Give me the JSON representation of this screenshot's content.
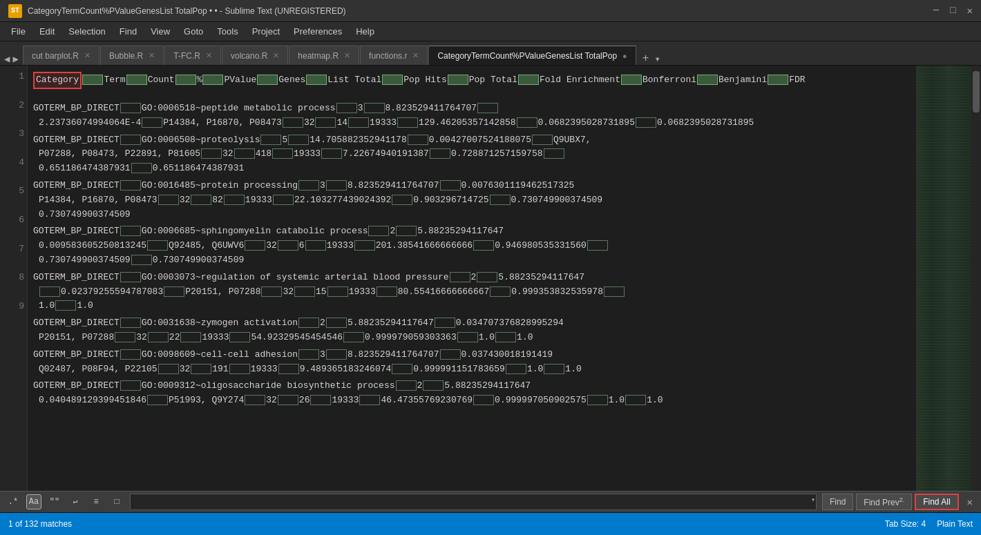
{
  "titlebar": {
    "icon_label": "ST",
    "title": "CategoryTermCount%PValueGenesList TotalPop • • - Sublime Text (UNREGISTERED)",
    "minimize": "─",
    "maximize": "□",
    "close": "✕"
  },
  "menubar": {
    "items": [
      "File",
      "Edit",
      "Selection",
      "Find",
      "View",
      "Goto",
      "Tools",
      "Project",
      "Preferences",
      "Help"
    ]
  },
  "tabs": [
    {
      "label": "cut barplot.R",
      "active": false,
      "closeable": true
    },
    {
      "label": "Bubble.R",
      "active": false,
      "closeable": true
    },
    {
      "label": "T-FC.R",
      "active": false,
      "closeable": true
    },
    {
      "label": "volcano.R",
      "active": false,
      "closeable": true
    },
    {
      "label": "heatmap.R",
      "active": false,
      "closeable": true
    },
    {
      "label": "functions.r",
      "active": false,
      "closeable": true
    },
    {
      "label": "CategoryTermCount%PValueGenesList TotalPop",
      "active": true,
      "closeable": true
    }
  ],
  "editor": {
    "lines": [
      {
        "num": 1,
        "content": "Category\tTerm\tCount\t%\tPValue\tGenes\tList Total\tPop Hits\tPop Total\tFold Enrichment\tBonferroni\tBenjamini\tFDR"
      },
      {
        "num": 2,
        "content": "GOTERM_BP_DIRECT\tGO:0006518~peptide metabolic process\t3\t8.823529411764707\t2.23736074994064E-4\tP14384, P16870, P08473\t32\t14\t19333\t129.46205357142858\t0.0682395028731895\t0.0682395028731895"
      },
      {
        "num": 3,
        "content": "GOTERM_BP_DIRECT\tGO:0006508~proteolysis\t5\t14.705882352941178\t0.00427007524188075\tQ9UBX7, P07288, P08473, P22891, P81605\t32\t418\t19333\t7.22674940191387\t0.728871257159758\t0.651186474387931\t0.651186474387931"
      },
      {
        "num": 4,
        "content": "GOTERM_BP_DIRECT\tGO:0016485~protein processing\t3\t8.823529411764707\t0.00763011194625175\tP14384, P16870, P08473\t32\t82\t19333\t22.103277439024392\t0.903296714725\t0.730749900374509\t0.730749900374509"
      },
      {
        "num": 5,
        "content": "GOTERM_BP_DIRECT\tGO:0006685~sphingomyelin catabolic process\t2\t5.88235294117647\t0.009583605250813245\tQ92485, Q6UWV6\t32\t6\t19333\t201.385416666666\t0.946980535331560\t0.730749900374509\t0.730749900374509"
      },
      {
        "num": 6,
        "content": "GOTERM_BP_DIRECT\tGO:0003073~regulation of systemic arterial blood pressure\t2\t5.88235294117647\t0.0237925559478670\tP20151, P07288\t32\t15\t19333\t80.5541666666667\t0.999353832535978\t1.0\t1.0"
      },
      {
        "num": 7,
        "content": "GOTERM_BP_DIRECT\tGO:0031638~zymogen activation\t2\t5.88235294117647\t0.034707376828995294\tP20151, P07288\t32\t22\t19333\t54.92329545454546\t0.999979059303363\t1.0\t1.0"
      },
      {
        "num": 8,
        "content": "GOTERM_BP_DIRECT\tGO:0098609~cell-cell adhesion\t3\t8.823529411764707\t0.037430018191419\tQ02487, P08F94, P22105\t32\t191\t19333\t9.489365183246074\t0.999991151783659\t1.0\t1.0"
      },
      {
        "num": 9,
        "content": "GOTERM_BP_DIRECT\tGO:0009312~oligosaccharide biosynthetic process\t2\t5.88235294117647\t0.040489129399451846\tP51993, Q9Y274\t32\t26\t19333\t46.47355769230769\t0.999997050902575\t1.0\t1.0"
      }
    ]
  },
  "search_bar": {
    "regex_label": ".*",
    "case_label": "Aa",
    "word_label": "\"\"",
    "wrap_label": "↩",
    "select_label": "≡",
    "highlight_label": "□",
    "input_value": "",
    "find_label": "Find",
    "find_prev_label": "Find Prev",
    "find_all_label": "Find All",
    "close_label": "✕",
    "match_count": "1 of 132 matches"
  },
  "statusbar": {
    "match_count": "1 of 132 matches",
    "tab_size": "Tab Size: 4",
    "file_type": "Plain Text"
  }
}
